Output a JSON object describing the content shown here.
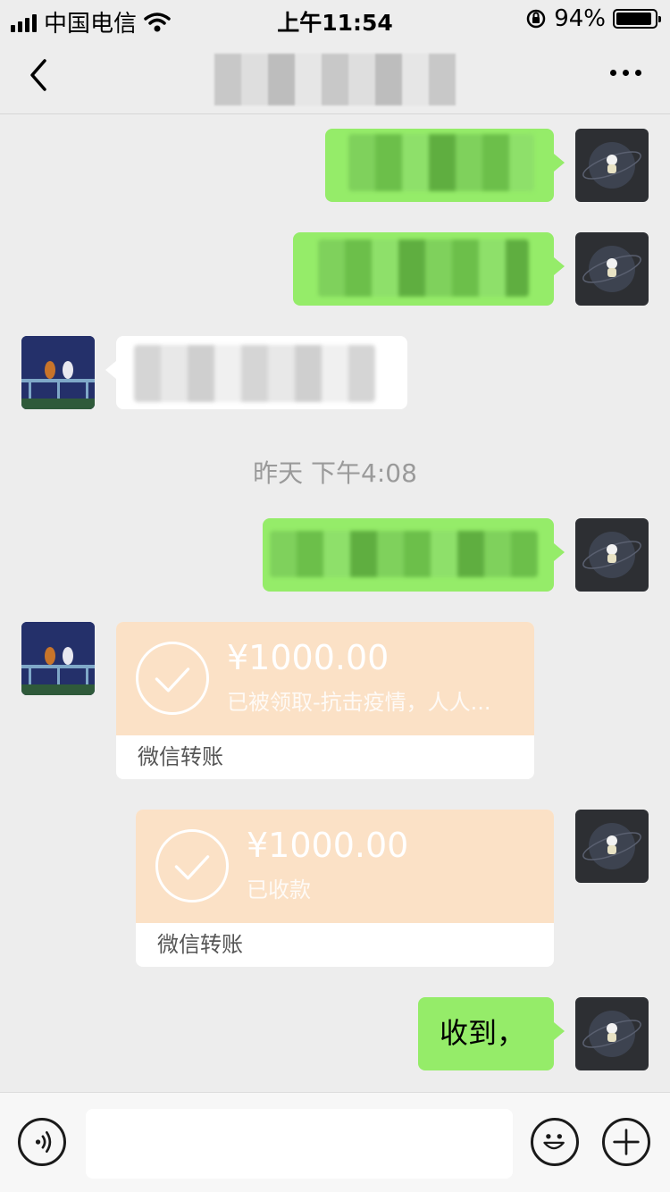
{
  "status_bar": {
    "carrier": "中国电信",
    "time": "上午11:54",
    "battery_percent": "94%",
    "battery_level": 0.94
  },
  "nav": {
    "back_icon": "chevron-left-icon",
    "more_icon": "ellipsis-icon"
  },
  "chat": {
    "timestamp": "昨天 下午4:08",
    "transfer_received": {
      "amount": "¥1000.00",
      "note": "已被领取-抗击疫情，人人...",
      "footer": "微信转账"
    },
    "transfer_confirm": {
      "amount": "¥1000.00",
      "note": "已收款",
      "footer": "微信转账"
    },
    "last_message": "收到，"
  },
  "input_bar": {
    "voice_icon": "voice-icon",
    "emoji_icon": "emoji-icon",
    "plus_icon": "plus-icon",
    "placeholder": ""
  },
  "colors": {
    "sent_bubble": "#95ec69",
    "received_bubble": "#ffffff",
    "transfer_card": "#fbe1c6",
    "background": "#ededed"
  }
}
